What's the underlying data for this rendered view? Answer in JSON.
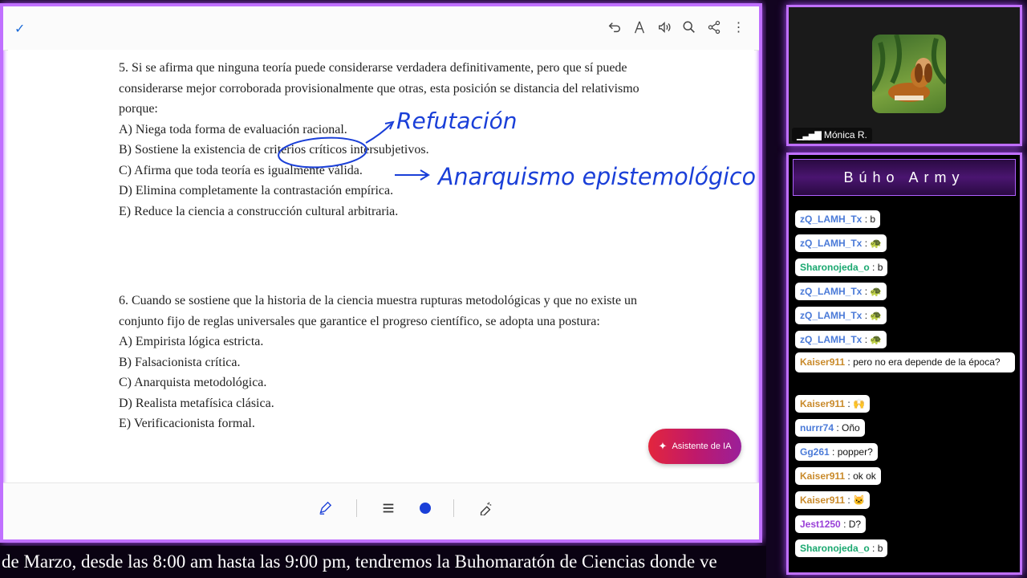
{
  "document": {
    "question5": {
      "stem": "5. Si se afirma que ninguna teoría puede considerarse verdadera definitivamente, pero que sí puede considerarse mejor corroborada provisionalmente que otras, esta posición se distancia del relativismo porque:",
      "options": [
        "A) Niega toda forma de evaluación racional.",
        "B) Sostiene la existencia de criterios críticos intersubjetivos.",
        "C) Afirma que toda teoría es igualmente válida.",
        "D) Elimina completamente la contrastación empírica.",
        "E) Reduce la ciencia a construcción cultural arbitraria."
      ]
    },
    "question6": {
      "stem": "6. Cuando se sostiene que la historia de la ciencia muestra rupturas metodológicas y que no existe un conjunto fijo de reglas universales que garantice el progreso científico, se adopta una postura:",
      "options": [
        "A) Empirista lógica estricta.",
        "B) Falsacionista crítica.",
        "C) Anarquista metodológica.",
        "D) Realista metafísica clásica.",
        "E) Verificacionista formal."
      ]
    },
    "annotations": {
      "ink1": "Refutación",
      "ink2": "Anarquismo epistemológico"
    },
    "ai_button": "Asistente de IA",
    "pen_color": "#1a3fd8"
  },
  "ticker": "de Marzo, desde las 8:00 am hasta las 9:00 pm, tendremos la Buhomaratón de Ciencias donde ve",
  "camera": {
    "name": "Mónica R."
  },
  "chat": {
    "title": "Búho Army",
    "messages": [
      {
        "user": "zQ_LAMH_Tx",
        "text": ": b",
        "color": "blue"
      },
      {
        "user": "zQ_LAMH_Tx",
        "text": ":",
        "emoji": "🐢",
        "color": "blue"
      },
      {
        "user": "Sharonojeda_o",
        "text": ": b",
        "color": "green"
      },
      {
        "user": "zQ_LAMH_Tx",
        "text": ":",
        "emoji": "🐢",
        "color": "blue"
      },
      {
        "user": "zQ_LAMH_Tx",
        "text": ":",
        "emoji": "🐢",
        "color": "blue"
      },
      {
        "user": "zQ_LAMH_Tx",
        "text": ":",
        "emoji": "🐢",
        "color": "blue"
      },
      {
        "user": "Kaiser911",
        "text": ": pero no era depende de la época?",
        "color": "gold"
      },
      {
        "user": "Kaiser911",
        "text": ":",
        "emoji": "🙌",
        "color": "gold"
      },
      {
        "user": "nurrr74",
        "text": ": Oño",
        "color": "blue"
      },
      {
        "user": "Gg261",
        "text": ": popper?",
        "color": "blue"
      },
      {
        "user": "Kaiser911",
        "text": ": ok ok",
        "color": "gold"
      },
      {
        "user": "Kaiser911",
        "text": ":",
        "emoji": "🐱",
        "color": "gold"
      },
      {
        "user": "Jest1250",
        "text": ": D?",
        "color": "purple"
      },
      {
        "user": "Sharonojeda_o",
        "text": ": b",
        "color": "green"
      }
    ]
  }
}
